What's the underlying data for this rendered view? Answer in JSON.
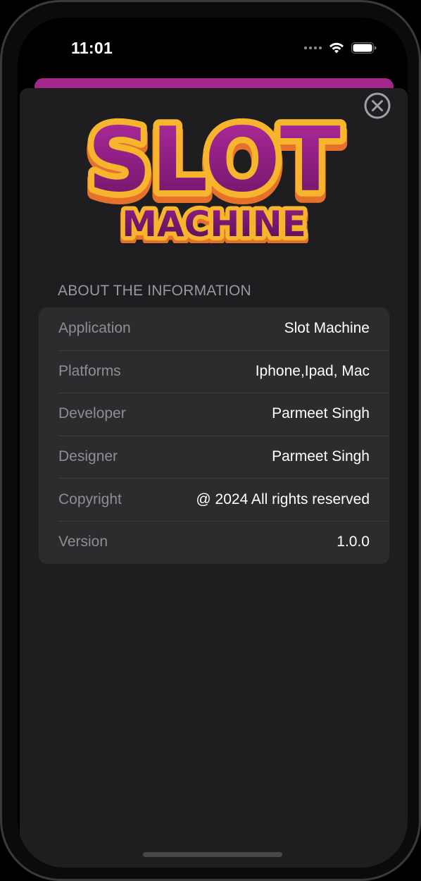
{
  "status_bar": {
    "time": "11:01"
  },
  "logo": {
    "line1": "SLOT",
    "line2": "MACHINE"
  },
  "section": {
    "header": "ABOUT THE INFORMATION"
  },
  "info_rows": [
    {
      "label": "Application",
      "value": "Slot Machine"
    },
    {
      "label": "Platforms",
      "value": "Iphone,Ipad, Mac"
    },
    {
      "label": "Developer",
      "value": "Parmeet Singh"
    },
    {
      "label": "Designer",
      "value": "Parmeet Singh"
    },
    {
      "label": "Copyright",
      "value": "@ 2024 All rights reserved"
    },
    {
      "label": "Version",
      "value": "1.0.0"
    }
  ],
  "colors": {
    "accent": "#a3268f",
    "sheet_background": "#1e1e20",
    "card_background": "#2c2c2e",
    "logo_fill": "#8e1f86",
    "logo_outline": "#f6b52c"
  },
  "icons": {
    "close": "close-circle-icon",
    "wifi": "wifi-icon",
    "battery": "battery-icon",
    "signal": "cellular-signal-icon"
  }
}
